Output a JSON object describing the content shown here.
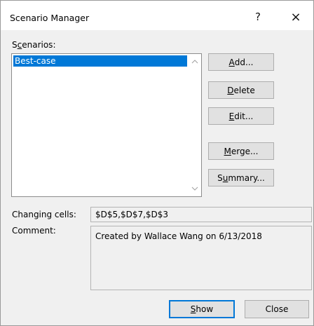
{
  "dialog": {
    "title": "Scenario Manager",
    "help_label": "?",
    "close_label": "×"
  },
  "scenarios": {
    "label_prefix": "S",
    "label_accel": "c",
    "label_suffix": "enarios:",
    "items": [
      "Best-case"
    ],
    "selected_index": 0
  },
  "buttons": {
    "add": {
      "accel": "A",
      "rest": "dd..."
    },
    "delete": {
      "accel": "D",
      "rest": "elete"
    },
    "edit": {
      "accel": "E",
      "rest": "dit..."
    },
    "merge": {
      "accel": "M",
      "rest": "erge..."
    },
    "summary": {
      "pre": "S",
      "accel": "u",
      "rest": "mmary..."
    },
    "show": {
      "accel": "S",
      "rest": "how"
    },
    "close": "Close"
  },
  "details": {
    "changing_cells_label": "Changing cells:",
    "changing_cells_value": "$D$5,$D$7,$D$3",
    "comment_label": "Comment:",
    "comment_value": "Created by Wallace Wang on 6/13/2018"
  },
  "colors": {
    "selection": "#0078d7",
    "dialog_bg": "#f0f0f0"
  }
}
